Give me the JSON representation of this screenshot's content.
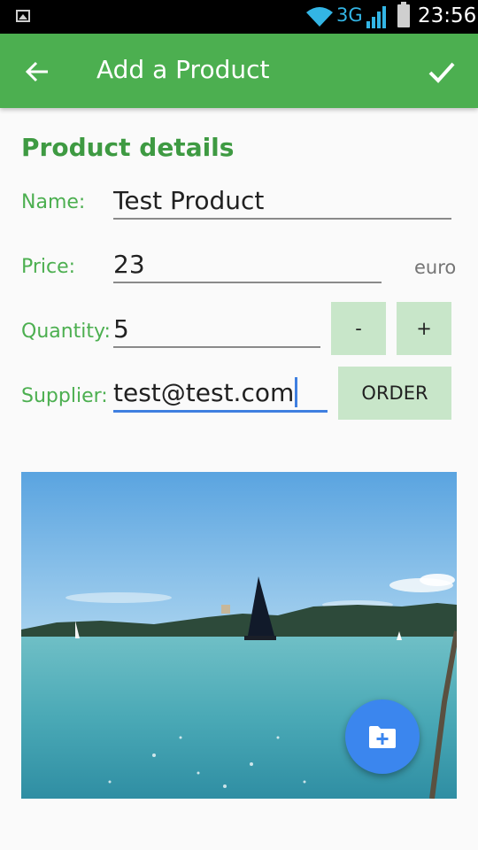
{
  "status_bar": {
    "network": "3G",
    "time": "23:56"
  },
  "app_bar": {
    "title": "Add a Product"
  },
  "form": {
    "section_title": "Product details",
    "name_label": "Name:",
    "name_value": "Test Product",
    "price_label": "Price:",
    "price_value": "23",
    "price_unit": "euro",
    "quantity_label": "Quantity:",
    "quantity_value": "5",
    "decrease_label": "-",
    "increase_label": "+",
    "supplier_label": "Supplier:",
    "supplier_value": "test@test.com",
    "order_label": "ORDER"
  },
  "icons": {
    "back": "arrow-back-icon",
    "save": "check-icon",
    "fab": "add-folder-icon"
  },
  "colors": {
    "app_bar": "#4caf50",
    "accent": "#3b86ee",
    "button_bg": "#c8e6c9"
  }
}
